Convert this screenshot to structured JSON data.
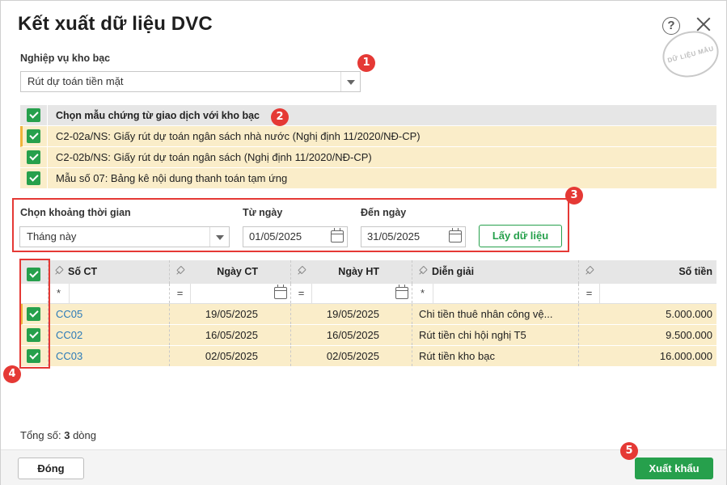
{
  "dialog": {
    "title": "Kết xuất dữ liệu DVC",
    "help_glyph": "?",
    "watermark": "DỮ LIỆU MẪU"
  },
  "treasury": {
    "label": "Nghiệp vụ kho bạc",
    "selected": "Rút dự toán tiền mặt"
  },
  "templates": {
    "header": "Chọn mẫu chứng từ giao dịch với kho bạc",
    "items": [
      {
        "label": "C2-02a/NS: Giấy rút dự toán ngân sách nhà nước (Nghị định 11/2020/NĐ-CP)",
        "checked": true
      },
      {
        "label": "C2-02b/NS: Giấy rút dự toán ngân sách (Nghị định 11/2020/NĐ-CP)",
        "checked": true
      },
      {
        "label": "Mẫu số 07: Bảng kê nội dung thanh toán tạm ứng",
        "checked": true
      }
    ]
  },
  "period": {
    "label": "Chọn khoảng thời gian",
    "selected": "Tháng này",
    "from_label": "Từ ngày",
    "from_value": "01/05/2025",
    "to_label": "Đến ngày",
    "to_value": "31/05/2025",
    "fetch_button": "Lấy dữ liệu"
  },
  "grid": {
    "columns": [
      "Số CT",
      "Ngày CT",
      "Ngày HT",
      "Diễn giải",
      "Số tiền"
    ],
    "filter_ops": [
      "*",
      "=",
      "=",
      "*",
      "="
    ],
    "rows": [
      {
        "so_ct": "CC05",
        "ngay_ct": "19/05/2025",
        "ngay_ht": "19/05/2025",
        "dien_giai": "Chi tiền thuê nhân công vệ...",
        "so_tien": "5.000.000"
      },
      {
        "so_ct": "CC02",
        "ngay_ct": "16/05/2025",
        "ngay_ht": "16/05/2025",
        "dien_giai": "Rút tiền chi hội nghị T5",
        "so_tien": "9.500.000"
      },
      {
        "so_ct": "CC03",
        "ngay_ct": "02/05/2025",
        "ngay_ht": "02/05/2025",
        "dien_giai": "Rút tiền kho bạc",
        "so_tien": "16.000.000"
      }
    ]
  },
  "summary": {
    "prefix": "Tổng số:",
    "count": "3",
    "suffix": "dòng"
  },
  "footer": {
    "close_button": "Đóng",
    "export_button": "Xuất khẩu"
  },
  "badges": [
    "1",
    "2",
    "3",
    "4",
    "5"
  ],
  "colors": {
    "accent_green": "#26a04c",
    "highlight_row": "#faedc9",
    "annotation_red": "#e53935",
    "link_blue": "#2a7ab8"
  }
}
